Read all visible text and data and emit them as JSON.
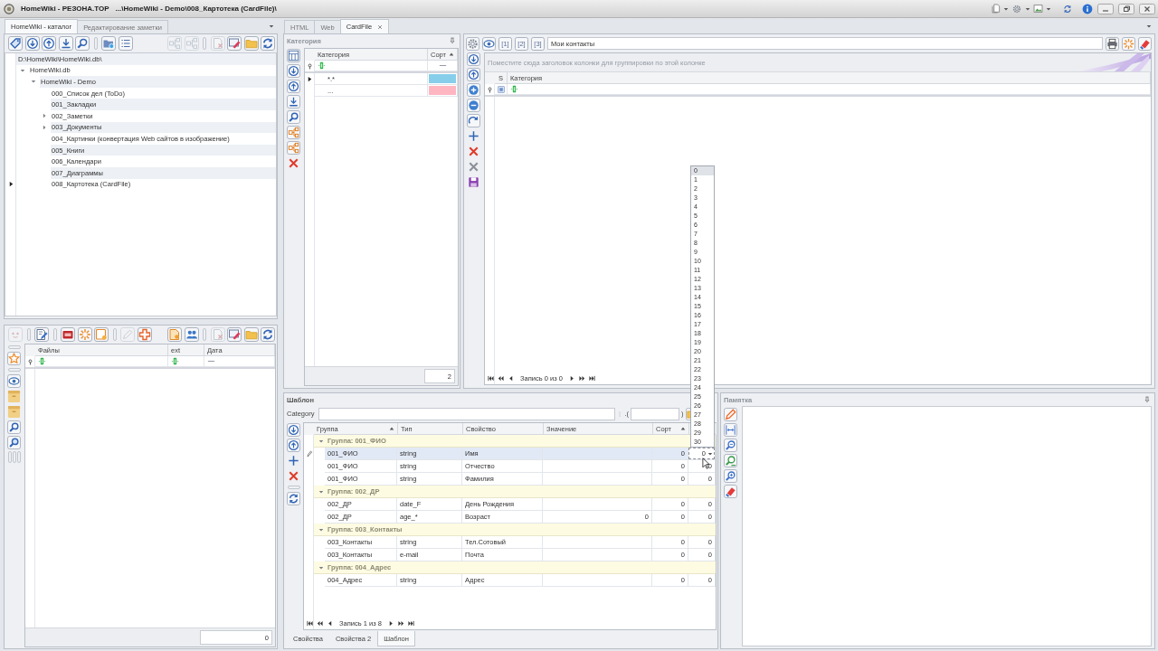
{
  "window": {
    "title": "HomeWiki - РЕЗОНА.TOP",
    "path": "...\\HomeWiki - Demo\\008_Картотека (CardFile)\\"
  },
  "catalog": {
    "tabs": [
      {
        "label": "HomeWiki - каталог",
        "selected": true
      },
      {
        "label": "Редактирование заметки",
        "selected": false
      }
    ],
    "toolbar": [
      {
        "disabled": false
      },
      {
        "disabled": false
      },
      {
        "disabled": false
      },
      {
        "disabled": false
      },
      {
        "disabled": false
      },
      {
        "disabled": false
      },
      {
        "disabled": false
      },
      {
        "disabled": true
      },
      {
        "disabled": true
      },
      {
        "disabled": true
      },
      {
        "disabled": false
      },
      {
        "disabled": false
      },
      {
        "disabled": false
      }
    ],
    "tree": {
      "path": "D:\\HomeWiki\\HomeWiki.db\\",
      "nodes": [
        {
          "label": "HomeWiki.db",
          "expanded": true,
          "selected": false,
          "children": [
            {
              "label": "HomeWiki - Demo",
              "expanded": true,
              "selected": false,
              "children": [
                {
                  "label": "000_Список дел (ToDo)",
                  "selected": false
                },
                {
                  "label": "001_Закладки",
                  "selected": false
                },
                {
                  "label": "002_Заметки",
                  "expanded": false,
                  "selected": false
                },
                {
                  "label": "003_Документы",
                  "expanded": false,
                  "selected": false
                },
                {
                  "label": "004_Картинки (конвертация Web сайтов в изображение)",
                  "selected": false
                },
                {
                  "label": "005_Книги",
                  "selected": false
                },
                {
                  "label": "006_Календари",
                  "selected": false
                },
                {
                  "label": "007_Диаграммы",
                  "selected": false
                },
                {
                  "label": "008_Картотека (CardFile)",
                  "selected": true
                }
              ]
            }
          ]
        }
      ]
    }
  },
  "files": {
    "toolbar": [
      {
        "disabled": true
      },
      {
        "disabled": false
      },
      {
        "disabled": false
      },
      {
        "disabled": false
      },
      {
        "disabled": false
      },
      {
        "disabled": true
      },
      {
        "disabled": false
      },
      {
        "disabled": false
      },
      {
        "disabled": false
      },
      {
        "disabled": true
      },
      {
        "disabled": false
      },
      {
        "disabled": false
      },
      {
        "disabled": false
      }
    ],
    "columns": [
      "Файлы",
      "ext",
      "Дата"
    ],
    "count": "0"
  },
  "document_tabs": [
    {
      "label": "HTML",
      "selected": false,
      "closable": false
    },
    {
      "label": "Web",
      "selected": false,
      "closable": false
    },
    {
      "label": "CardFile",
      "selected": true,
      "closable": true
    }
  ],
  "categories": {
    "title": "Категория",
    "columns": [
      {
        "label": "Категория",
        "sorted": false
      },
      {
        "label": "Сорт",
        "sorted": true
      }
    ],
    "rows": [
      {
        "name": "*.*",
        "color": "#87ceeb",
        "selected": true
      },
      {
        "name": "...",
        "color": "#ffb6c1",
        "selected": false
      }
    ],
    "count": "2"
  },
  "contacts": {
    "buttons": [
      "[1]",
      "[2]",
      "[3]"
    ],
    "name": "Мои контакты",
    "group_hint": "Поместите сюда заголовок колонки для группировки по этой колонке",
    "columns": [
      "S",
      "Категория"
    ],
    "navigator": "Запись 0 из 0"
  },
  "template": {
    "title": "Шаблон",
    "category_label": "Category",
    "open_bracket": ".(",
    "close_bracket": ")",
    "columns": [
      {
        "label": "Группа",
        "sorted": true
      },
      {
        "label": "Тип",
        "sorted": false
      },
      {
        "label": "Свойство",
        "sorted": false
      },
      {
        "label": "Значение",
        "sorted": false
      },
      {
        "label": "Сорт",
        "sorted": true
      }
    ],
    "groups": [
      {
        "label": "Группа: 001_ФИО",
        "expanded": true,
        "rows": [
          {
            "group": "001_ФИО",
            "type": "string",
            "property": "Имя",
            "sort": "0",
            "column_6": "0",
            "selected": true,
            "dropdown": {
              "options": [
                {
                  "label": "0",
                  "selected": true
                },
                {
                  "label": "1",
                  "selected": false
                },
                {
                  "label": "2",
                  "selected": false
                },
                {
                  "label": "3",
                  "selected": false
                },
                {
                  "label": "4",
                  "selected": false
                },
                {
                  "label": "5",
                  "selected": false
                },
                {
                  "label": "6",
                  "selected": false
                },
                {
                  "label": "7",
                  "selected": false
                },
                {
                  "label": "8",
                  "selected": false
                },
                {
                  "label": "9",
                  "selected": false
                },
                {
                  "label": "10",
                  "selected": false
                },
                {
                  "label": "11",
                  "selected": false
                },
                {
                  "label": "12",
                  "selected": false
                },
                {
                  "label": "13",
                  "selected": false
                },
                {
                  "label": "14",
                  "selected": false
                },
                {
                  "label": "15",
                  "selected": false
                },
                {
                  "label": "16",
                  "selected": false
                },
                {
                  "label": "17",
                  "selected": false
                },
                {
                  "label": "18",
                  "selected": false
                },
                {
                  "label": "19",
                  "selected": false
                },
                {
                  "label": "20",
                  "selected": false
                },
                {
                  "label": "21",
                  "selected": false
                },
                {
                  "label": "22",
                  "selected": false
                },
                {
                  "label": "23",
                  "selected": false
                },
                {
                  "label": "24",
                  "selected": false
                },
                {
                  "label": "25",
                  "selected": false
                },
                {
                  "label": "26",
                  "selected": false
                },
                {
                  "label": "27",
                  "selected": false
                },
                {
                  "label": "28",
                  "selected": false
                },
                {
                  "label": "29",
                  "selected": false
                },
                {
                  "label": "30",
                  "selected": false
                }
              ]
            }
          },
          {
            "group": "001_ФИО",
            "type": "string",
            "property": "Отчество",
            "sort": "0",
            "column_6": "0",
            "selected": false
          },
          {
            "group": "001_ФИО",
            "type": "string",
            "property": "Фамилия",
            "sort": "0",
            "column_6": "0",
            "selected": false
          }
        ]
      },
      {
        "label": "Группа: 002_ДР",
        "expanded": true,
        "rows": [
          {
            "group": "002_ДР",
            "type": "date_F",
            "property": "День Рождения",
            "sort": "0",
            "column_6": "0",
            "selected": false
          },
          {
            "group": "002_ДР",
            "type": "age_*",
            "property": "Возраст",
            "value": "0",
            "sort": "0",
            "column_6": "0",
            "selected": false
          }
        ]
      },
      {
        "label": "Группа: 003_Контакты",
        "expanded": true,
        "rows": [
          {
            "group": "003_Контакты",
            "type": "string",
            "property": "Тел.Сотовый",
            "sort": "0",
            "column_6": "0",
            "selected": false
          },
          {
            "group": "003_Контакты",
            "type": "e-mail",
            "property": "Почта",
            "sort": "0",
            "column_6": "0",
            "selected": false
          }
        ]
      },
      {
        "label": "Группа: 004_Адрес",
        "expanded": true,
        "rows": [
          {
            "group": "004_Адрес",
            "type": "string",
            "property": "Адрес",
            "sort": "0",
            "column_6": "0",
            "selected": false
          }
        ]
      }
    ],
    "navigator": "Запись 1 из 8",
    "tabs": [
      {
        "label": "Свойства",
        "selected": false
      },
      {
        "label": "Свойства 2",
        "selected": false
      },
      {
        "label": "Шаблон",
        "selected": true
      }
    ]
  },
  "memo": {
    "title": "Памятка"
  }
}
